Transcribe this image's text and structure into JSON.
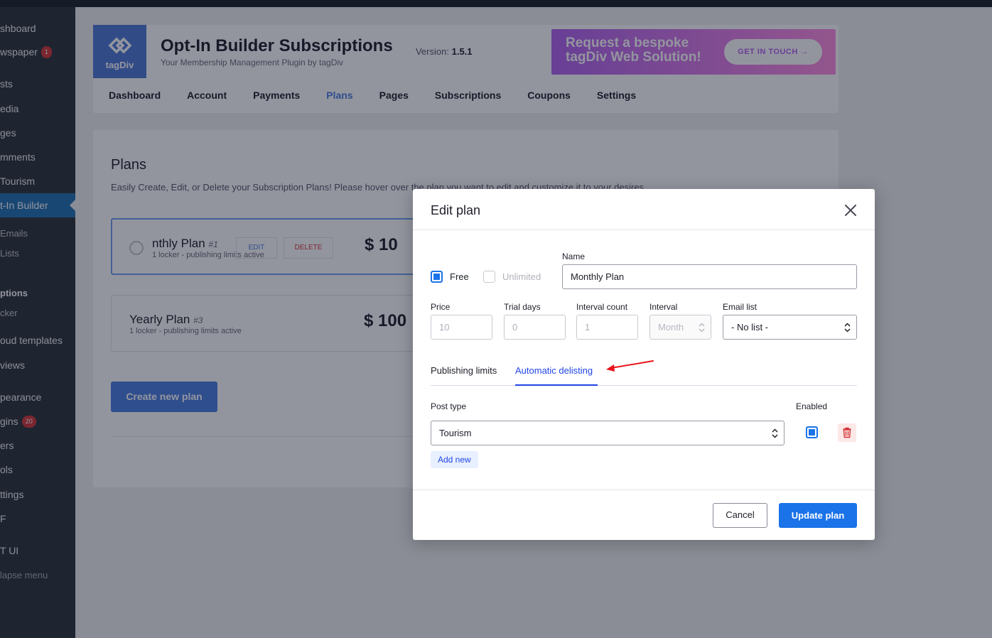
{
  "sidebar": {
    "items": [
      {
        "label": "shboard"
      },
      {
        "label": "wspaper",
        "badge": "1"
      },
      {
        "label": "sts"
      },
      {
        "label": "edia"
      },
      {
        "label": "ges"
      },
      {
        "label": "mments"
      },
      {
        "label": " Tourism"
      },
      {
        "label": "t-In Builder"
      },
      {
        "label": " Emails"
      },
      {
        "label": " Lists"
      },
      {
        "label": "ptions"
      },
      {
        "label": "cker"
      },
      {
        "label": "oud templates"
      },
      {
        "label": "views"
      },
      {
        "label": "pearance"
      },
      {
        "label": "gins",
        "badge": "20"
      },
      {
        "label": "ers"
      },
      {
        "label": "ols"
      },
      {
        "label": "ttings"
      },
      {
        "label": "F"
      },
      {
        "label": "T UI"
      },
      {
        "label": "lapse menu"
      }
    ]
  },
  "plugin": {
    "logo_text": "tagDiv",
    "title": "Opt-In Builder Subscriptions",
    "subtitle": "Your Membership Management Plugin by tagDiv",
    "version_label": "Version:",
    "version_value": "1.5.1",
    "banner_line1": "Request a bespoke",
    "banner_line2": "tagDiv Web Solution!",
    "banner_button": "GET IN TOUCH →",
    "nav": [
      "Dashboard",
      "Account",
      "Payments",
      "Plans",
      "Pages",
      "Subscriptions",
      "Coupons",
      "Settings"
    ],
    "nav_active": "Plans"
  },
  "plans": {
    "title": "Plans",
    "description": "Easily Create, Edit, or Delete your Subscription Plans! Please hover over the plan you want to edit and customize it to your desires.",
    "cards": [
      {
        "name": "nthly Plan",
        "id": "#1",
        "meta": "1 locker - publishing limits active",
        "price": "$ 10",
        "edit": "EDIT",
        "delete": "DELETE"
      },
      {
        "name": "Yearly Plan",
        "id": "#3",
        "meta": "1 locker - publishing limits active",
        "price": "$ 100"
      }
    ],
    "create_button": "Create new plan"
  },
  "modal": {
    "title": "Edit plan",
    "free_label": "Free",
    "free_checked": true,
    "unlimited_label": "Unlimited",
    "unlimited_checked": false,
    "name_label": "Name",
    "name_value": "Monthly Plan",
    "price_label": "Price",
    "price_placeholder": "10",
    "trial_label": "Trial days",
    "trial_placeholder": "0",
    "interval_count_label": "Interval count",
    "interval_count_placeholder": "1",
    "interval_label": "Interval",
    "interval_value": "Month",
    "email_list_label": "Email list",
    "email_list_value": "- No list -",
    "tabs": [
      "Publishing limits",
      "Automatic delisting"
    ],
    "active_tab": "Automatic delisting",
    "post_type_label": "Post type",
    "post_type_value": "Tourism",
    "enabled_label": "Enabled",
    "enabled_checked": true,
    "add_new": "Add new",
    "cancel": "Cancel",
    "update": "Update plan"
  },
  "colors": {
    "accent": "#1a73e8",
    "tab_active": "#2145e6",
    "annotation_arrow": "#e8151b",
    "delete_red": "#d63638"
  }
}
